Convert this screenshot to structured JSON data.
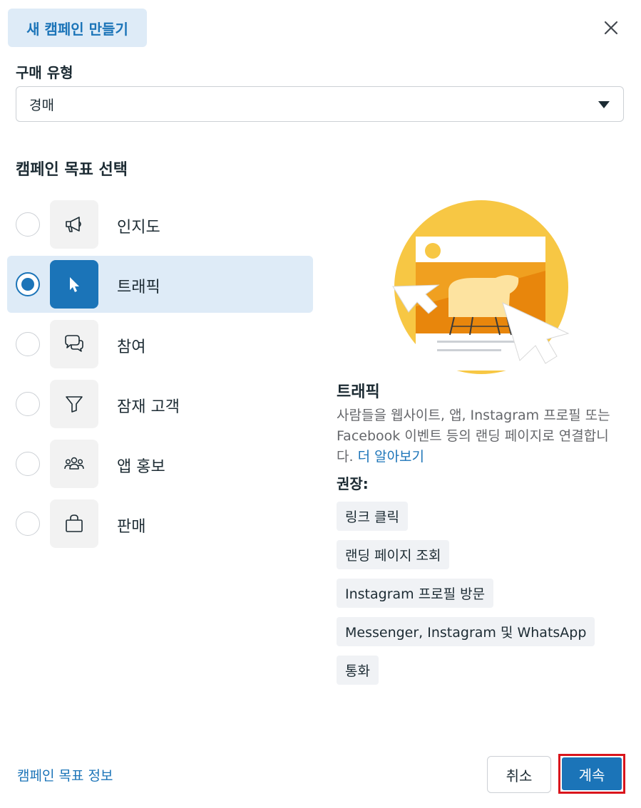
{
  "dialog": {
    "title": "새 캠페인 만들기"
  },
  "buy_type": {
    "label": "구매 유형",
    "value": "경매"
  },
  "objectives": {
    "title": "캠페인 목표 선택",
    "items": [
      {
        "label": "인지도",
        "icon": "megaphone-icon",
        "selected": false
      },
      {
        "label": "트래픽",
        "icon": "cursor-icon",
        "selected": true
      },
      {
        "label": "참여",
        "icon": "chat-bubbles-icon",
        "selected": false
      },
      {
        "label": "잠재 고객",
        "icon": "funnel-icon",
        "selected": false
      },
      {
        "label": "앱 홍보",
        "icon": "people-icon",
        "selected": false
      },
      {
        "label": "판매",
        "icon": "shopping-bag-icon",
        "selected": false
      }
    ]
  },
  "details": {
    "title": "트래픽",
    "description": "사람들을 웹사이트, 앱, Instagram 프로필 또는 Facebook 이벤트 등의 랜딩 페이지로 연결합니다.",
    "learn_more": "더 알아보기",
    "recommended_label": "권장:",
    "recommended": [
      "링크 클릭",
      "랜딩 페이지 조회",
      "Instagram 프로필 방문",
      "Messenger, Instagram 및 WhatsApp",
      "통화"
    ]
  },
  "footer": {
    "info_link": "캠페인 목표 정보",
    "cancel": "취소",
    "continue": "계속"
  },
  "colors": {
    "accent": "#1b74b8",
    "selected_bg": "#deebf7",
    "highlight_border": "#d9151c"
  }
}
